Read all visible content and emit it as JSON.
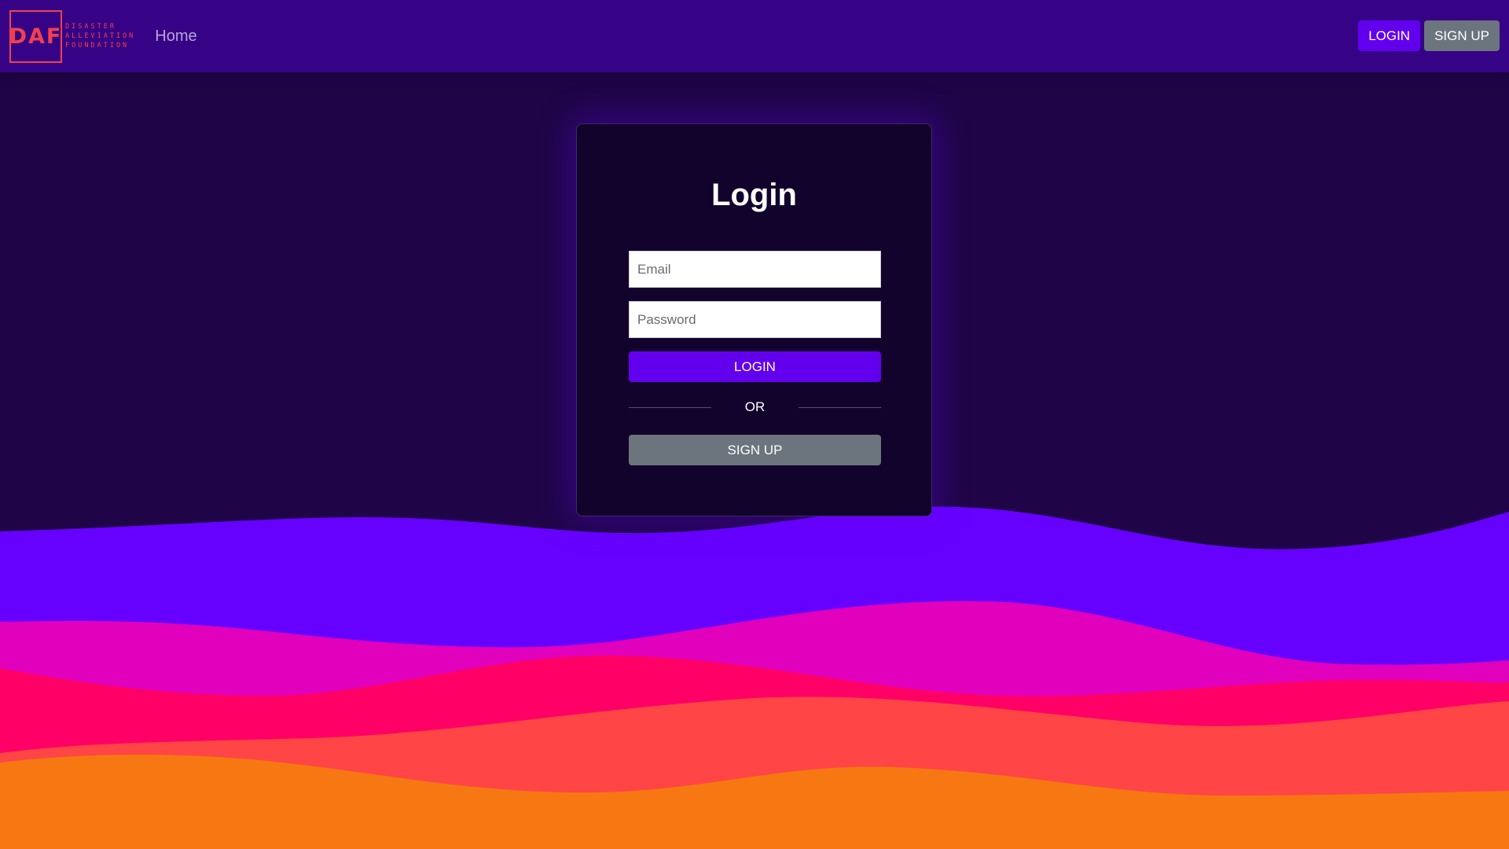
{
  "header": {
    "logo_mark": "DAF",
    "logo_lines": [
      "DISASTER",
      "ALLEVIATION",
      "FOUNDATION"
    ],
    "home_link": "Home",
    "login_button": "LOGIN",
    "signup_button": "SIGN UP"
  },
  "login_card": {
    "title": "Login",
    "email_placeholder": "Email",
    "password_placeholder": "Password",
    "login_button": "LOGIN",
    "divider_text": "OR",
    "signup_button": "SIGN UP"
  },
  "colors": {
    "navbar": "#360286",
    "background": "#1f0547",
    "card": "#12032c",
    "primary": "#6200ee",
    "secondary": "#6c757d",
    "accent": "#f0414f",
    "wave_purple": "#6600ff",
    "wave_magenta": "#e100bb",
    "wave_pink": "#ff0066",
    "wave_coral": "#ff4545",
    "wave_orange": "#f77812"
  }
}
